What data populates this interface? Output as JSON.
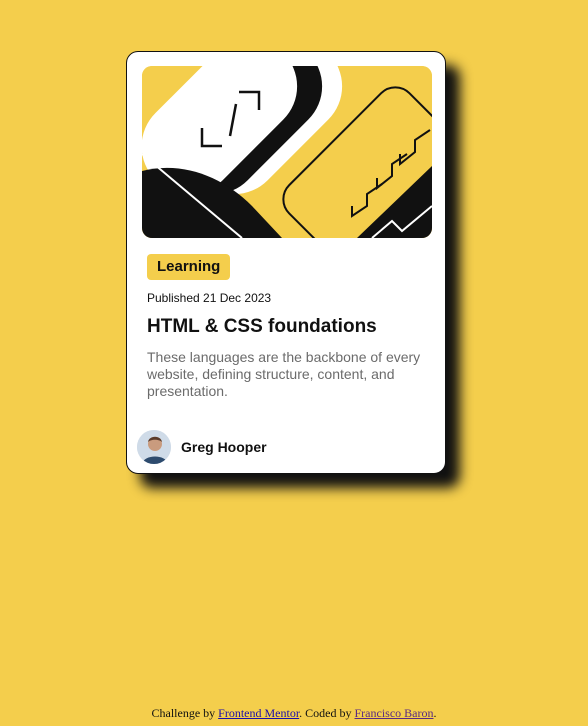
{
  "card": {
    "category": "Learning",
    "published": "Published 21 Dec 2023",
    "title": "HTML & CSS foundations",
    "description": "These languages are the backbone of every website, defining structure, content, and presentation.",
    "author": "Greg Hooper"
  },
  "footer": {
    "prefix": "Challenge by ",
    "link1": "Frontend Mentor",
    "middle": ". Coded by ",
    "link2": "Francisco Baron",
    "suffix": "."
  },
  "colors": {
    "background": "#f4ce4c",
    "card": "#ffffff",
    "text": "#111111",
    "muted": "#6b6b6b"
  }
}
